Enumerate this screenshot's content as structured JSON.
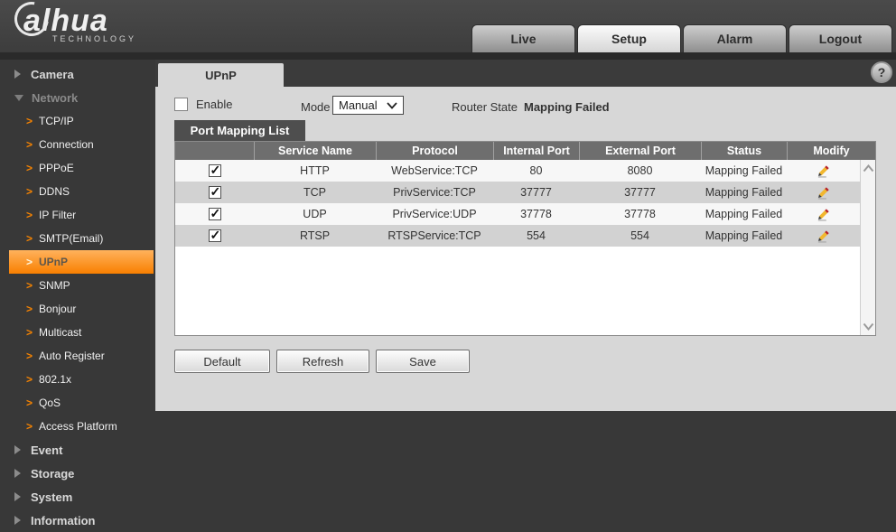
{
  "header": {
    "brand": "alhua",
    "brand_sub": "TECHNOLOGY",
    "tabs": [
      {
        "label": "Live",
        "active": false
      },
      {
        "label": "Setup",
        "active": true
      },
      {
        "label": "Alarm",
        "active": false
      },
      {
        "label": "Logout",
        "active": false
      }
    ]
  },
  "help": {
    "label": "?"
  },
  "sidebar": {
    "items": [
      {
        "type": "section",
        "label": "Camera",
        "expanded": false
      },
      {
        "type": "section",
        "label": "Network",
        "expanded": true
      },
      {
        "type": "sub",
        "label": "TCP/IP",
        "active": false
      },
      {
        "type": "sub",
        "label": "Connection",
        "active": false
      },
      {
        "type": "sub",
        "label": "PPPoE",
        "active": false
      },
      {
        "type": "sub",
        "label": "DDNS",
        "active": false
      },
      {
        "type": "sub",
        "label": "IP Filter",
        "active": false
      },
      {
        "type": "sub",
        "label": "SMTP(Email)",
        "active": false
      },
      {
        "type": "sub",
        "label": "UPnP",
        "active": true
      },
      {
        "type": "sub",
        "label": "SNMP",
        "active": false
      },
      {
        "type": "sub",
        "label": "Bonjour",
        "active": false
      },
      {
        "type": "sub",
        "label": "Multicast",
        "active": false
      },
      {
        "type": "sub",
        "label": "Auto Register",
        "active": false
      },
      {
        "type": "sub",
        "label": "802.1x",
        "active": false
      },
      {
        "type": "sub",
        "label": "QoS",
        "active": false
      },
      {
        "type": "sub",
        "label": "Access Platform",
        "active": false
      },
      {
        "type": "section",
        "label": "Event",
        "expanded": false
      },
      {
        "type": "section",
        "label": "Storage",
        "expanded": false
      },
      {
        "type": "section",
        "label": "System",
        "expanded": false
      },
      {
        "type": "section",
        "label": "Information",
        "expanded": false
      }
    ]
  },
  "content": {
    "tab_label": "UPnP",
    "enable_label": "Enable",
    "enable_checked": false,
    "mode_label": "Mode",
    "mode_value": "Manual",
    "router_state_label": "Router State",
    "router_state_value": "Mapping Failed",
    "list_title": "Port Mapping List",
    "table": {
      "columns": [
        "",
        "Service Name",
        "Protocol",
        "Internal Port",
        "External Port",
        "Status",
        "Modify"
      ],
      "rows": [
        {
          "checked": true,
          "service_name": "HTTP",
          "protocol": "WebService:TCP",
          "internal_port": "80",
          "external_port": "8080",
          "status": "Mapping Failed"
        },
        {
          "checked": true,
          "service_name": "TCP",
          "protocol": "PrivService:TCP",
          "internal_port": "37777",
          "external_port": "37777",
          "status": "Mapping Failed"
        },
        {
          "checked": true,
          "service_name": "UDP",
          "protocol": "PrivService:UDP",
          "internal_port": "37778",
          "external_port": "37778",
          "status": "Mapping Failed"
        },
        {
          "checked": true,
          "service_name": "RTSP",
          "protocol": "RTSPService:TCP",
          "internal_port": "554",
          "external_port": "554",
          "status": "Mapping Failed"
        }
      ]
    },
    "buttons": [
      "Default",
      "Refresh",
      "Save"
    ]
  },
  "colors": {
    "accent_orange": "#f98500",
    "dark_bg": "#383838",
    "panel_bg": "#d7d7d7",
    "table_header_bg": "#6e6e6e",
    "row_light": "#f7f7f7",
    "row_dark": "#d2d2d2"
  }
}
